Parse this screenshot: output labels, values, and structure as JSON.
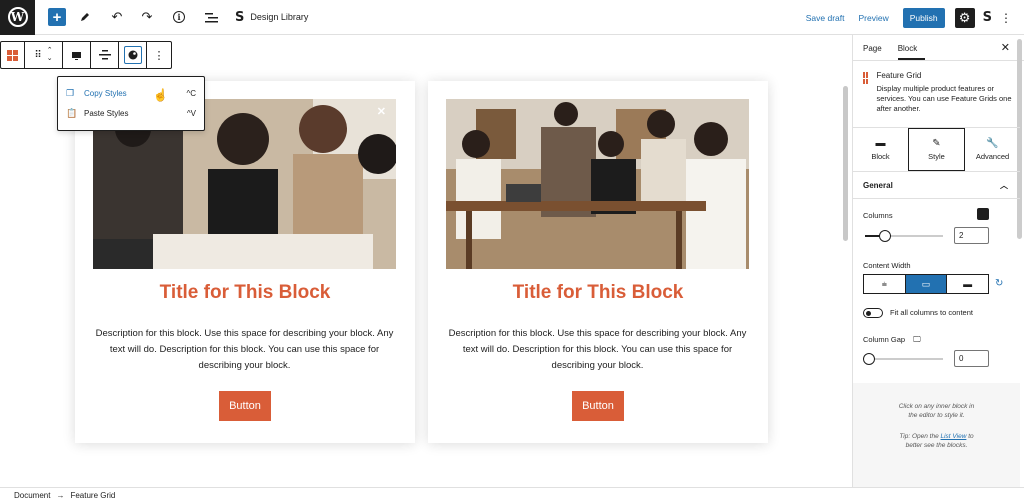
{
  "topbar": {
    "site_label": "Design Library",
    "save_draft": "Save draft",
    "preview": "Preview",
    "publish": "Publish"
  },
  "popover": {
    "items": [
      {
        "label": "Copy Styles",
        "shortcut": "^C"
      },
      {
        "label": "Paste Styles",
        "shortcut": "^V"
      }
    ]
  },
  "cards": [
    {
      "title": "Title for This Block",
      "description": "Description for this block. Use this space for describing your block. Any text will do. Description for this block. You can use this space for describing your block.",
      "button": "Button"
    },
    {
      "title": "Title for This Block",
      "description": "Description for this block. Use this space for describing your block. Any text will do. Description for this block. You can use this space for describing your block.",
      "button": "Button"
    }
  ],
  "sidebar": {
    "tabs": [
      "Page",
      "Block"
    ],
    "block_name": "Feature Grid",
    "block_description": "Display multiple product features or services. You can use Feature Grids one after another.",
    "style_tabs": [
      "Block",
      "Style",
      "Advanced"
    ],
    "section": "General",
    "columns_label": "Columns",
    "columns_value": "2",
    "content_width_label": "Content Width",
    "fit_label": "Fit all columns to content",
    "column_gap_label": "Column Gap",
    "column_gap_value": "0",
    "help_line1": "Click on any inner block in",
    "help_line2": "the editor to style it.",
    "tip_prefix": "Tip: Open the ",
    "tip_link": "List View",
    "tip_suffix": " to",
    "tip_line2": "better see the blocks."
  },
  "breadcrumb": {
    "root": "Document",
    "current": "Feature Grid"
  },
  "colors": {
    "accent": "#2271b1",
    "brand_orange": "#d95d38"
  }
}
